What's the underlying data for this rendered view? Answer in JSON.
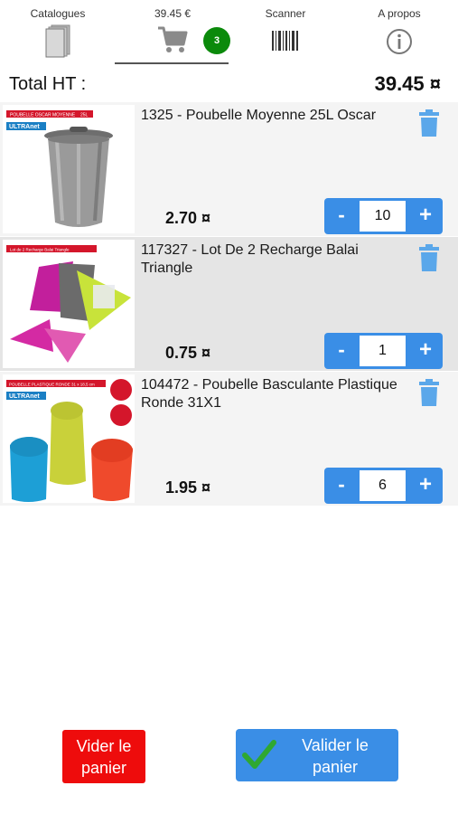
{
  "tabs": [
    {
      "label": "Catalogues",
      "icon": "catalogues-icon"
    },
    {
      "label": "39.45 €",
      "icon": "cart-icon",
      "badge": "3",
      "active": true
    },
    {
      "label": "Scanner",
      "icon": "barcode-icon"
    },
    {
      "label": "A propos",
      "icon": "info-icon"
    }
  ],
  "total": {
    "label": "Total HT :",
    "value": "39.45 ¤"
  },
  "products": [
    {
      "name": "1325 - Poubelle Moyenne 25L Oscar",
      "price": "2.70 ¤",
      "quantity": "10",
      "image_banner": "POUBELLE OSCAR MOYENNE",
      "image_banner_right": "25L",
      "image_brand": "ULTRAnet"
    },
    {
      "name": "117327 - Lot De 2 Recharge Balai Triangle",
      "price": "0.75 ¤",
      "quantity": "1",
      "image_banner": "Lot de 2 Recharge Balai Triangle"
    },
    {
      "name": "104472 - Poubelle Basculante Plastique Ronde 31X1",
      "price": "1.95 ¤",
      "quantity": "6",
      "image_banner": "POUBELLE PLASTIQUE RONDE 31 x 18,5 cm",
      "image_brand": "ULTRAnet"
    }
  ],
  "stepper": {
    "minus": "-",
    "plus": "+"
  },
  "actions": {
    "empty_cart": "Vider le panier",
    "validate_cart": "Valider le panier"
  },
  "colors": {
    "accent": "#3a8ee6",
    "danger": "#ee0c0c",
    "badge": "#0b8a0b",
    "check": "#2fa832"
  }
}
